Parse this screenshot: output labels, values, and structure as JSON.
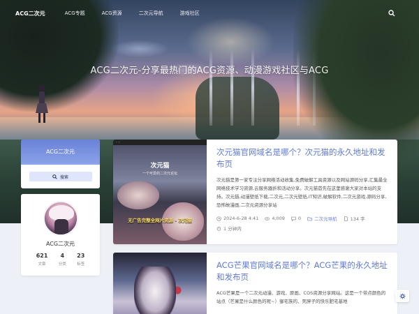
{
  "nav": {
    "brand": "ACG二次元",
    "items": [
      "ACG专题",
      "ACG资源",
      "二次元导航",
      "游戏社区"
    ]
  },
  "hero": {
    "title": "ACG二次元-分享最热门的ACG资源、动漫游戏社区与ACG"
  },
  "sidebar": {
    "site_name": "ACG二次元",
    "search_label": "搜索",
    "profile": {
      "name": "ACG二次元",
      "stats": [
        {
          "value": "621",
          "label": "文章"
        },
        {
          "value": "4",
          "label": "分类"
        },
        {
          "value": "23",
          "label": "标签"
        }
      ]
    }
  },
  "posts": [
    {
      "title": "次元猫官网域名是哪个？次元猫的永久地址和发布页",
      "thumb_caption_title": "次元猫",
      "thumb_caption_sub": "一个可爱的二次元论坛",
      "thumb_caption_banner": "无广告完整全网片资源 - 次元猫",
      "excerpt": "次元猫是第一家专注分享网络活动收集,免费破解工具资源以及网站源码分享,汇集最全网络技术学习资源,云服务器折和活动分享。次元猫首先在这里感谢大家对本站的支持。次元猫,动漫壁纸下载,二次元,二次元壁纸,IT知识,破解软件,二次元游戏,源码分享,恐怖故漫画,二次元资源分享站",
      "date": "2024-6-28 4:41",
      "views": "4,009",
      "comments": "0",
      "category": "二次元导航",
      "words": "134 字",
      "read_time": "1 分钟内"
    },
    {
      "title": "ACG芒果官网域名是哪个？ACG芒果的永久地址和发布页",
      "excerpt": "ACG芒果是一个二次元动漫、游戏、原画、COS资源分享网站。这是一个带点颜色的站点（芒果是什么颜色的呢~）御宅族的、死胖子的快乐肥宅基地"
    }
  ],
  "colors": {
    "accent": "#5f7ad6",
    "sidebar_band": "#7890e0",
    "page_bg": "#eef0f7"
  }
}
